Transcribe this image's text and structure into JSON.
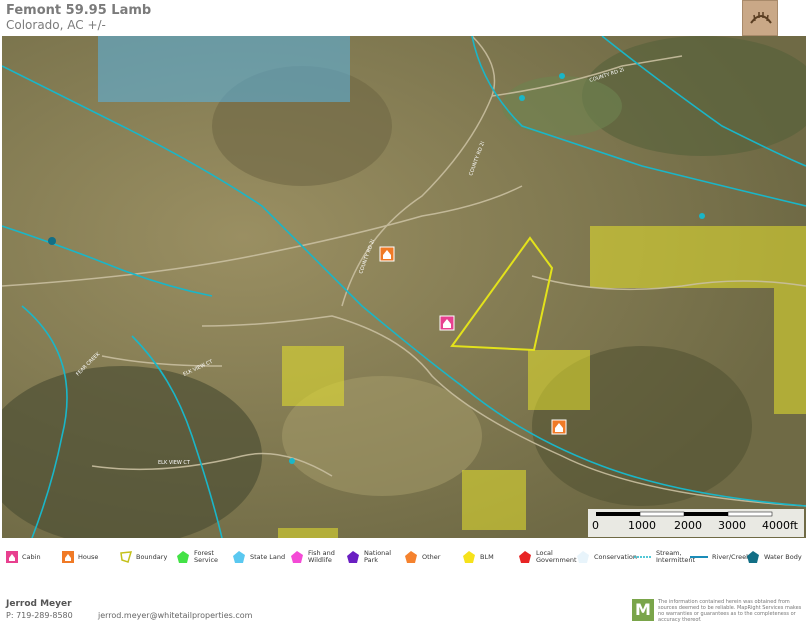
{
  "header": {
    "title": "Femont 59.95 Lamb",
    "subtitle": "Colorado,  AC +/-",
    "logo_icon": "antler-logo-icon"
  },
  "map": {
    "road_labels": [
      "COUNTY RD 2I",
      "COUNTY RD 2I",
      "COUNTY RD 2I",
      "FEAR CREEK",
      "ELK VIEW CT",
      "ELK VIEW CT"
    ],
    "colors": {
      "boundary": "#e3e21b",
      "blm": "#e6e12e",
      "state_land": "#5ab4e6",
      "stream": "#1ab6c8",
      "house": "#f07a26",
      "cabin": "#e8408f"
    },
    "scale": {
      "ticks": [
        "0",
        "1000",
        "2000",
        "3000",
        "4000ft"
      ]
    }
  },
  "legend": {
    "items": [
      {
        "label": "Cabin",
        "icon": "cabin-icon",
        "color": "#e8408f"
      },
      {
        "label": "House",
        "icon": "house-icon",
        "color": "#f07a26"
      },
      {
        "label": "Boundary",
        "icon": "boundary-icon",
        "color": "#e3e21b"
      },
      {
        "label": "Forest Service",
        "icon": "forest-service-icon",
        "color": "#43e246"
      },
      {
        "label": "State Land",
        "icon": "state-land-icon",
        "color": "#5ac8f0"
      },
      {
        "label": "Fish and Wildlife",
        "icon": "fish-wildlife-icon",
        "color": "#f44ad6"
      },
      {
        "label": "National Park",
        "icon": "national-park-icon",
        "color": "#6a1fc2"
      },
      {
        "label": "Other",
        "icon": "other-icon",
        "color": "#f5822e"
      },
      {
        "label": "BLM",
        "icon": "blm-icon",
        "color": "#f6e21b"
      },
      {
        "label": "Local Government",
        "icon": "local-government-icon",
        "color": "#e82424"
      },
      {
        "label": "Conservation",
        "icon": "conservation-icon",
        "color": "#e8f4fb"
      },
      {
        "label": "Stream, Intermittent",
        "icon": "stream-intermittent-icon",
        "color": "#1ab6c8"
      },
      {
        "label": "River/Creek",
        "icon": "river-creek-icon",
        "color": "#1a8cb8"
      },
      {
        "label": "Water Body",
        "icon": "water-body-icon",
        "color": "#126f86"
      }
    ]
  },
  "footer": {
    "name": "Jerrod Meyer",
    "phone": "P: 719-289-8580",
    "email": "jerrod.meyer@whitetailproperties.com",
    "brand_letter": "M",
    "disclaimer": "The information contained herein was obtained from sources deemed to be reliable. MapRight Services makes no warranties or guarantees as to the completeness or accuracy thereof."
  }
}
